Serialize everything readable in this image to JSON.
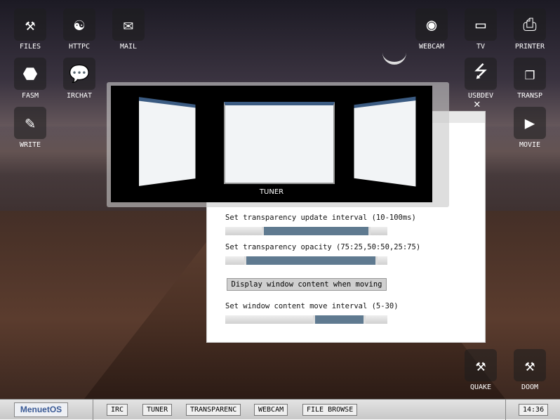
{
  "desktop": {
    "icons_left": [
      {
        "label": "FILES",
        "glyph": "⚒"
      },
      {
        "label": "HTTPC",
        "glyph": "☯"
      },
      {
        "label": "MAIL",
        "glyph": "✉"
      },
      {
        "label": "FASM",
        "glyph": "⬣"
      },
      {
        "label": "IRCHAT",
        "glyph": "💬"
      },
      {
        "label": "WRITE",
        "glyph": "✎"
      }
    ],
    "icons_right": [
      {
        "label": "WEBCAM",
        "glyph": "◉"
      },
      {
        "label": "TV",
        "glyph": "▭"
      },
      {
        "label": "PRINTER",
        "glyph": "⎙"
      },
      {
        "label": "USBDEV",
        "glyph": "⭍"
      },
      {
        "label": "TRANSP",
        "glyph": "❐"
      },
      {
        "label": "MOVIE",
        "glyph": "▶"
      },
      {
        "label": "QUAKE",
        "glyph": "⚒"
      },
      {
        "label": "DOOM",
        "glyph": "⚒"
      }
    ]
  },
  "switcher": {
    "selected": "TUNER"
  },
  "transp_window": {
    "interval_label": "Set transparency update interval (10-100ms)",
    "interval_value": 0.68,
    "opacity_label": "Set transparency opacity (75:25,50:50,25:75)",
    "opacity_value": 0.95,
    "display_button": "Display window content when moving",
    "move_label": "Set window content move interval (5-30)",
    "move_value": 0.8
  },
  "taskbar": {
    "menu": "MenuetOS",
    "items": [
      "IRC",
      "TUNER",
      "TRANSPARENC",
      "WEBCAM",
      "FILE BROWSE"
    ],
    "clock": "14:36"
  }
}
